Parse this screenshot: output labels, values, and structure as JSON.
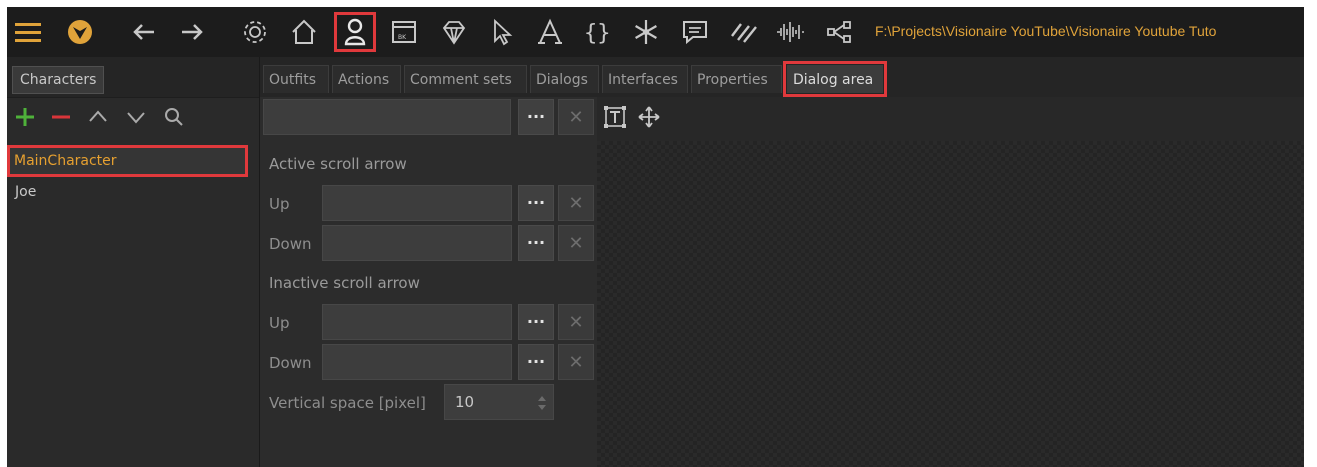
{
  "toolbar": {
    "path": "F:\\Projects\\Visionaire YouTube\\Visionaire Youtube Tuto",
    "icons": [
      "menu-icon",
      "logo-icon",
      "back-arrow-icon",
      "forward-arrow-icon",
      "gear-icon",
      "home-icon",
      "character-icon",
      "window-bk-icon",
      "diamond-icon",
      "pointer-icon",
      "font-icon",
      "braces-icon",
      "snowflake-icon",
      "comment-icon",
      "stripes-icon",
      "audio-wave-icon",
      "share-icon"
    ],
    "active": "character-icon",
    "accent": "#e0a33a",
    "highlight": "#e0393c"
  },
  "left_panel": {
    "tab": "Characters",
    "tools": [
      "add-icon",
      "remove-icon",
      "up-icon",
      "down-icon",
      "search-icon"
    ],
    "items": [
      "MainCharacter",
      "Joe"
    ],
    "selected": "MainCharacter"
  },
  "tabs": [
    "Outfits",
    "Actions",
    "Comment sets",
    "Dialogs",
    "Interfaces",
    "Properties",
    "Dialog area"
  ],
  "active_tab": "Dialog area",
  "form": {
    "top_field": "",
    "dots": "···",
    "close": "✕",
    "active_scroll_title": "Active scroll arrow",
    "inactive_scroll_title": "Inactive scroll arrow",
    "up_label": "Up",
    "down_label": "Down",
    "vertical_space_label": "Vertical space [pixel]",
    "vertical_space_value": "10"
  },
  "canvas_tools": [
    "text-frame-icon",
    "move-icon"
  ]
}
